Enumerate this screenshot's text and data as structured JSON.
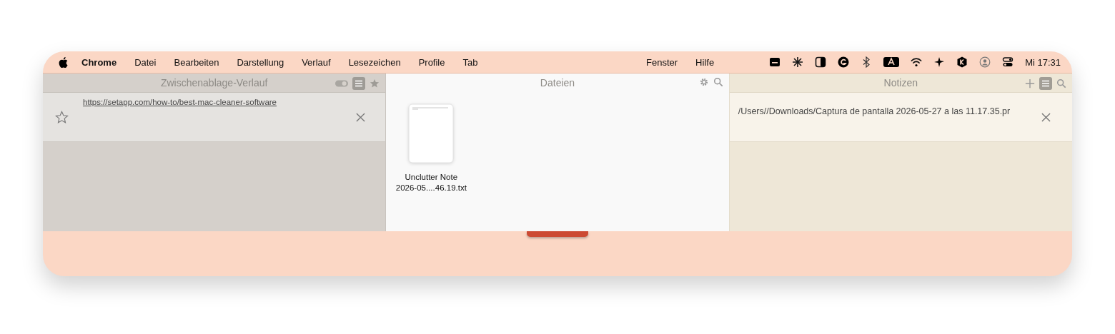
{
  "menu_bar": {
    "items": [
      {
        "label": "Chrome",
        "kind": "app"
      },
      {
        "label": "Datei",
        "kind": "menu"
      },
      {
        "label": "Bearbeiten",
        "kind": "menu"
      },
      {
        "label": "Darstellung",
        "kind": "menu"
      },
      {
        "label": "Verlauf",
        "kind": "menu"
      },
      {
        "label": "Lesezeichen",
        "kind": "menu"
      },
      {
        "label": "Profile",
        "kind": "menu"
      },
      {
        "label": "Tab",
        "kind": "menu"
      }
    ],
    "right_items": [
      "Fenster",
      "Hilfe"
    ],
    "clock": "Mi 17:31"
  },
  "clipboard": {
    "title": "Zwischenablage-Verlauf",
    "items": [
      {
        "text": "https://setapp.com/how-to/best-mac-cleaner-software",
        "starred": false
      }
    ]
  },
  "files": {
    "title": "Dateien",
    "files": [
      {
        "lines": [
          "Unclutter Note",
          "2026-05....46.19.txt"
        ]
      }
    ]
  },
  "notes": {
    "title": "Notizen",
    "items": [
      {
        "text": "/Users//Downloads/Captura de pantalla 2026-05-27 a las 11.17.35.pr"
      }
    ]
  }
}
